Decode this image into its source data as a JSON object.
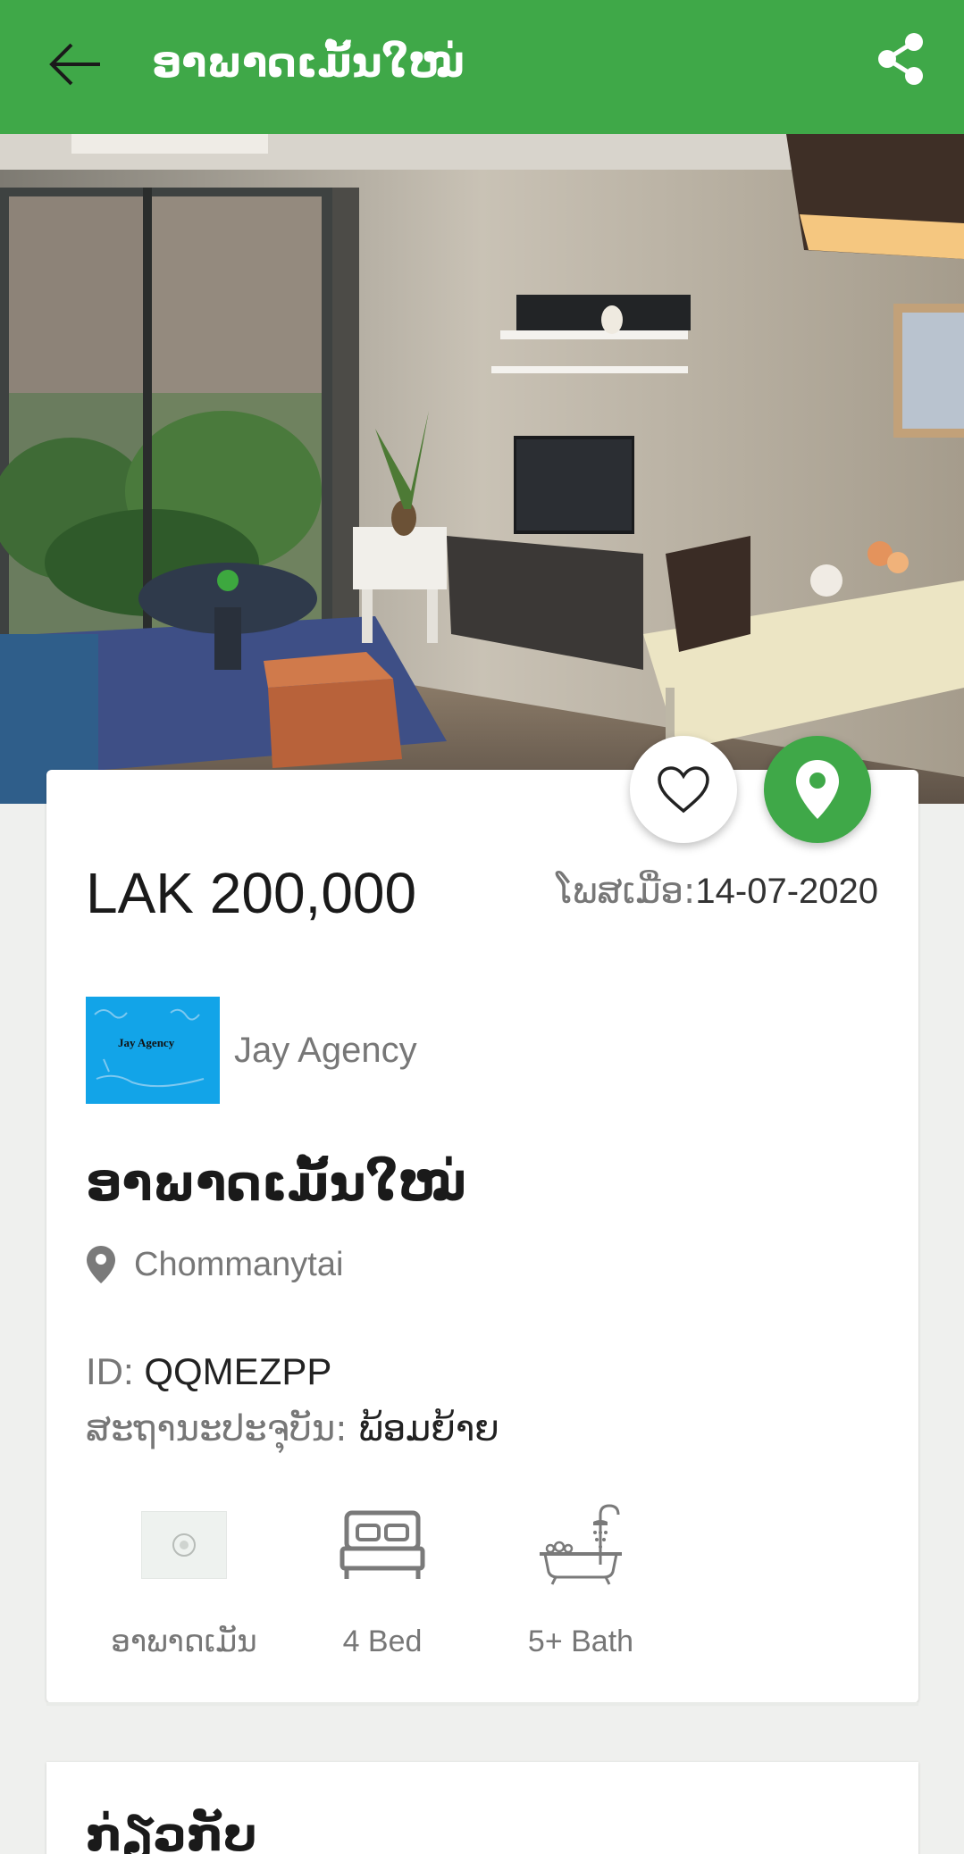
{
  "appbar": {
    "title": "ອາພາດເມັ້ນໃໝ່",
    "back_icon": "arrow-left-icon",
    "share_icon": "share-icon",
    "background": "#3fa848"
  },
  "hero": {
    "image_icon": "living-room-photo"
  },
  "actions": {
    "favorite_icon": "heart-outline-icon",
    "map_icon": "map-pin-icon"
  },
  "listing": {
    "price": "LAK 200,000",
    "posted_label": "ໂພສເມື່ອ:",
    "posted_date": "14-07-2020",
    "agent_name": "Jay Agency",
    "agent_logo_text": "Jay Agency",
    "title": "ອາພາດເມັ້ນໃໝ່",
    "location": "Chommanytai",
    "id_label": "ID:",
    "id_value": "QQMEZPP",
    "status_label": "ສະຖານະປະຈຸບັນ:",
    "status_value": "ພ້ອມຍ້າຍ"
  },
  "features": [
    {
      "label": "ອາພາດເມັນ",
      "icon": "property-type-icon"
    },
    {
      "label": "4 Bed",
      "icon": "bed-icon"
    },
    {
      "label": "5+ Bath",
      "icon": "bathtub-icon"
    }
  ],
  "next_section": {
    "title": "ກ່ຽວກັບ"
  }
}
